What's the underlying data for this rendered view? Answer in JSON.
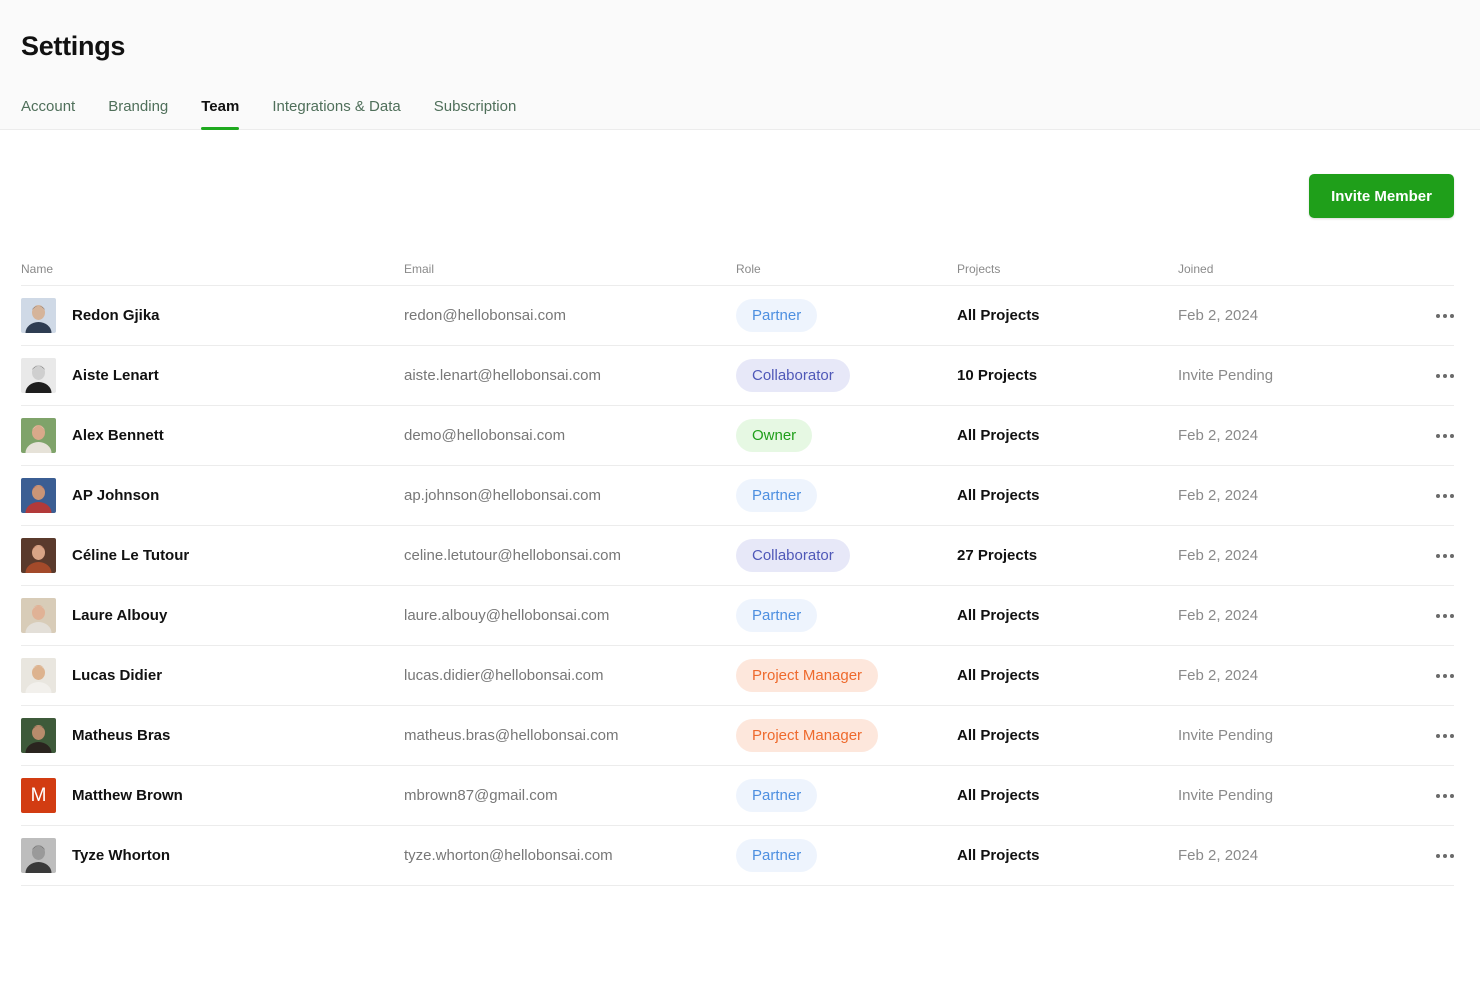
{
  "page": {
    "title": "Settings",
    "tabs": [
      {
        "label": "Account",
        "active": false
      },
      {
        "label": "Branding",
        "active": false
      },
      {
        "label": "Team",
        "active": true
      },
      {
        "label": "Integrations & Data",
        "active": false
      },
      {
        "label": "Subscription",
        "active": false
      }
    ],
    "invite_label": "Invite Member"
  },
  "colors": {
    "accent": "#1f9f1a",
    "partner_bg": "#eef4fd",
    "partner_fg": "#4d8fe0",
    "collaborator_bg": "#e7e8f8",
    "collaborator_fg": "#4f58b8",
    "owner_bg": "#e6f8e3",
    "owner_fg": "#1f9f1a",
    "pm_bg": "#fde7dc",
    "pm_fg": "#ee6a2d"
  },
  "table": {
    "columns": [
      "Name",
      "Email",
      "Role",
      "Projects",
      "Joined"
    ],
    "rows": [
      {
        "name": "Redon Gjika",
        "email": "redon@hellobonsai.com",
        "role": "Partner",
        "role_type": "partner",
        "projects": "All Projects",
        "joined": "Feb 2, 2024",
        "avatar": "photo-avatar",
        "avatar_tone": [
          "#cfd9e6",
          "#2f3d52",
          "#d5b49a"
        ]
      },
      {
        "name": "Aiste Lenart",
        "email": "aiste.lenart@hellobonsai.com",
        "role": "Collaborator",
        "role_type": "collaborator",
        "projects": "10 Projects",
        "joined": "Invite Pending",
        "avatar": "photo-avatar",
        "avatar_tone": [
          "#e9e9e9",
          "#1e1e1e",
          "#cfcfcf"
        ]
      },
      {
        "name": "Alex Bennett",
        "email": "demo@hellobonsai.com",
        "role": "Owner",
        "role_type": "owner",
        "projects": "All Projects",
        "joined": "Feb 2, 2024",
        "avatar": "photo-avatar",
        "avatar_tone": [
          "#7fa36a",
          "#e6e2d8",
          "#d9a98a"
        ]
      },
      {
        "name": "AP Johnson",
        "email": "ap.johnson@hellobonsai.com",
        "role": "Partner",
        "role_type": "partner",
        "projects": "All Projects",
        "joined": "Feb 2, 2024",
        "avatar": "photo-avatar",
        "avatar_tone": [
          "#3b5e93",
          "#b23a3a",
          "#c99577"
        ]
      },
      {
        "name": "Céline Le Tutour",
        "email": "celine.letutour@hellobonsai.com",
        "role": "Collaborator",
        "role_type": "collaborator",
        "projects": "27 Projects",
        "joined": "Feb 2, 2024",
        "avatar": "photo-avatar",
        "avatar_tone": [
          "#5a3a2c",
          "#a34a2a",
          "#d8a486"
        ]
      },
      {
        "name": "Laure Albouy",
        "email": "laure.albouy@hellobonsai.com",
        "role": "Partner",
        "role_type": "partner",
        "projects": "All Projects",
        "joined": "Feb 2, 2024",
        "avatar": "photo-avatar",
        "avatar_tone": [
          "#d8ccb8",
          "#e3dfd8",
          "#e0b296"
        ]
      },
      {
        "name": "Lucas Didier",
        "email": "lucas.didier@hellobonsai.com",
        "role": "Project Manager",
        "role_type": "pm",
        "projects": "All Projects",
        "joined": "Feb 2, 2024",
        "avatar": "photo-avatar",
        "avatar_tone": [
          "#e9e6df",
          "#f2f0ec",
          "#ddb38f"
        ]
      },
      {
        "name": "Matheus Bras",
        "email": "matheus.bras@hellobonsai.com",
        "role": "Project Manager",
        "role_type": "pm",
        "projects": "All Projects",
        "joined": "Invite Pending",
        "avatar": "photo-avatar",
        "avatar_tone": [
          "#3e5a3a",
          "#2a241f",
          "#b88c6c"
        ]
      },
      {
        "name": "Matthew Brown",
        "email": "mbrown87@gmail.com",
        "role": "Partner",
        "role_type": "partner",
        "projects": "All Projects",
        "joined": "Invite Pending",
        "avatar": "initial-avatar",
        "initial": "M"
      },
      {
        "name": "Tyze Whorton",
        "email": "tyze.whorton@hellobonsai.com",
        "role": "Partner",
        "role_type": "partner",
        "projects": "All Projects",
        "joined": "Feb 2, 2024",
        "avatar": "photo-avatar",
        "avatar_tone": [
          "#bdbdbd",
          "#3a3a3a",
          "#9a9a9a"
        ]
      }
    ]
  }
}
